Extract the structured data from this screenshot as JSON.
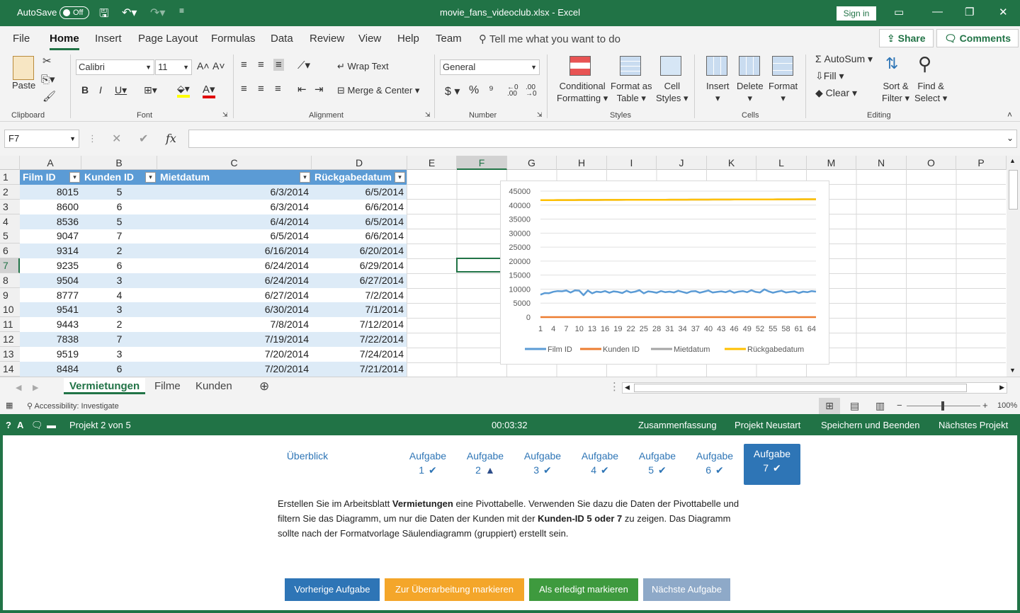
{
  "titlebar": {
    "autosave_label": "AutoSave",
    "autosave_state": "Off",
    "file_title": "movie_fans_videoclub.xlsx - Excel",
    "signin": "Sign in"
  },
  "menu": {
    "tabs": [
      "File",
      "Home",
      "Insert",
      "Page Layout",
      "Formulas",
      "Data",
      "Review",
      "View",
      "Help",
      "Team"
    ],
    "tell_me": "Tell me what you want to do",
    "share": "Share",
    "comments": "Comments"
  },
  "ribbon": {
    "paste": "Paste",
    "clipboard": "Clipboard",
    "font_name": "Calibri",
    "font_size": "11",
    "font": "Font",
    "wrap_text": "Wrap Text",
    "merge_center": "Merge & Center",
    "alignment": "Alignment",
    "number_format": "General",
    "number": "Number",
    "conditional": "Conditional",
    "formatting": "Formatting",
    "format_as": "Format as",
    "table": "Table",
    "cell": "Cell",
    "styles_btn": "Styles",
    "styles": "Styles",
    "insert": "Insert",
    "delete": "Delete",
    "format": "Format",
    "cells": "Cells",
    "autosum": "AutoSum",
    "fill": "Fill",
    "clear": "Clear",
    "sort": "Sort &",
    "filter": "Filter",
    "find": "Find &",
    "select": "Select",
    "editing": "Editing"
  },
  "formula": {
    "namebox": "F7",
    "fx": "fx"
  },
  "columns": [
    "A",
    "B",
    "C",
    "D",
    "E",
    "F",
    "G",
    "H",
    "I",
    "J",
    "K",
    "L",
    "M",
    "N",
    "O",
    "P"
  ],
  "table": {
    "headers": [
      "Film ID",
      "Kunden ID",
      "Mietdatum",
      "Rückgabedatum"
    ],
    "rows": [
      [
        "8015",
        "5",
        "6/3/2014",
        "6/5/2014"
      ],
      [
        "8600",
        "6",
        "6/3/2014",
        "6/6/2014"
      ],
      [
        "8536",
        "5",
        "6/4/2014",
        "6/5/2014"
      ],
      [
        "9047",
        "7",
        "6/5/2014",
        "6/6/2014"
      ],
      [
        "9314",
        "2",
        "6/16/2014",
        "6/20/2014"
      ],
      [
        "9235",
        "6",
        "6/24/2014",
        "6/29/2014"
      ],
      [
        "9504",
        "3",
        "6/24/2014",
        "6/27/2014"
      ],
      [
        "8777",
        "4",
        "6/27/2014",
        "7/2/2014"
      ],
      [
        "9541",
        "3",
        "6/30/2014",
        "7/1/2014"
      ],
      [
        "9443",
        "2",
        "7/8/2014",
        "7/12/2014"
      ],
      [
        "7838",
        "7",
        "7/19/2014",
        "7/22/2014"
      ],
      [
        "9519",
        "3",
        "7/20/2014",
        "7/24/2014"
      ],
      [
        "8484",
        "6",
        "7/20/2014",
        "7/21/2014"
      ]
    ]
  },
  "chart_data": {
    "type": "line",
    "ylim": [
      0,
      45000
    ],
    "yticks": [
      "45000",
      "40000",
      "35000",
      "30000",
      "25000",
      "20000",
      "15000",
      "10000",
      "5000",
      "0"
    ],
    "xticks": [
      "1",
      "4",
      "7",
      "10",
      "13",
      "16",
      "19",
      "22",
      "25",
      "28",
      "31",
      "34",
      "37",
      "40",
      "43",
      "46",
      "49",
      "52",
      "55",
      "58",
      "61",
      "64"
    ],
    "legend_position": "bottom",
    "series": [
      {
        "name": "Film ID",
        "color": "#5b9bd5",
        "values": [
          8015,
          8600,
          8536,
          9047,
          9314,
          9235,
          9504,
          8777,
          9541,
          9443,
          7838,
          9519,
          8484,
          9100,
          8900,
          9300,
          8700,
          9200,
          9000,
          8600,
          9400,
          8800,
          9100,
          9600,
          8500,
          9200,
          9000,
          8700,
          9300,
          8900,
          9100,
          8800,
          9400,
          9000,
          8600,
          9200,
          9300,
          8700,
          9100,
          9500,
          8800,
          9000,
          9200,
          8900,
          9400,
          8700,
          9100,
          9300,
          8900,
          9600,
          9000,
          8800,
          9900,
          9200,
          8700,
          9100,
          9400,
          8800,
          9000,
          9200,
          8600,
          9100,
          8900,
          9300,
          9100
        ]
      },
      {
        "name": "Kunden ID",
        "color": "#ed7d31",
        "values": [
          5,
          6,
          5,
          7,
          2,
          6,
          3,
          4,
          3,
          2,
          7,
          3,
          6,
          5,
          4,
          6,
          2,
          3,
          7,
          5,
          4,
          6,
          3,
          2,
          5,
          7,
          4,
          3,
          6,
          5,
          2,
          4,
          7,
          3,
          6,
          5,
          4,
          2,
          3,
          6,
          7,
          5,
          4,
          3,
          2,
          6,
          5,
          7,
          4,
          3,
          6,
          2,
          5,
          4,
          7,
          3,
          6,
          5,
          2,
          4,
          3,
          6,
          7,
          5,
          4
        ]
      },
      {
        "name": "Mietdatum",
        "color": "#a5a5a5",
        "values": [
          41793,
          41793,
          41794,
          41795,
          41806,
          41814,
          41814,
          41817,
          41820,
          41828,
          41839,
          41840,
          41840,
          41845,
          41850,
          41855,
          41860,
          41865,
          41870,
          41875,
          41880,
          41885,
          41890,
          41895,
          41900,
          41905,
          41910,
          41915,
          41920,
          41925,
          41930,
          41935,
          41940,
          41945,
          41950,
          41955,
          41960,
          41965,
          41970,
          41975,
          41980,
          41985,
          41990,
          41995,
          42000,
          42005,
          42010,
          42015,
          42020,
          42025,
          42030,
          42035,
          42040,
          42045,
          42050,
          42055,
          42060,
          42065,
          42070,
          42075,
          42080,
          42085,
          42090,
          42095,
          42100
        ]
      },
      {
        "name": "Rückgabedatum",
        "color": "#ffc000",
        "values": [
          41795,
          41796,
          41795,
          41796,
          41810,
          41819,
          41817,
          41822,
          41821,
          41832,
          41842,
          41844,
          41841,
          41848,
          41853,
          41858,
          41863,
          41868,
          41873,
          41878,
          41883,
          41888,
          41893,
          41898,
          41903,
          41908,
          41913,
          41918,
          41923,
          41928,
          41933,
          41938,
          41943,
          41948,
          41953,
          41958,
          41963,
          41968,
          41973,
          41978,
          41983,
          41988,
          41993,
          41998,
          42003,
          42008,
          42013,
          42018,
          42023,
          42028,
          42033,
          42038,
          42043,
          42048,
          42053,
          42058,
          42063,
          42068,
          42073,
          42078,
          42083,
          42088,
          42093,
          42098,
          42103
        ]
      }
    ]
  },
  "sheets": [
    "Vermietungen",
    "Filme",
    "Kunden"
  ],
  "status": {
    "accessibility": "Accessibility: Investigate",
    "zoom": "100%"
  },
  "project": {
    "label": "Projekt 2 von 5",
    "timer": "00:03:32",
    "summary": "Zusammenfassung",
    "restart": "Projekt Neustart",
    "save_exit": "Speichern und Beenden",
    "next_project": "Nächstes Projekt"
  },
  "tasks": {
    "overview": "Überblick",
    "items": [
      {
        "label": "Aufgabe",
        "num": "1",
        "mark": "✔"
      },
      {
        "label": "Aufgabe",
        "num": "2",
        "mark": "▲"
      },
      {
        "label": "Aufgabe",
        "num": "3",
        "mark": "✔"
      },
      {
        "label": "Aufgabe",
        "num": "4",
        "mark": "✔"
      },
      {
        "label": "Aufgabe",
        "num": "5",
        "mark": "✔"
      },
      {
        "label": "Aufgabe",
        "num": "6",
        "mark": "✔"
      },
      {
        "label": "Aufgabe",
        "num": "7",
        "mark": "✔"
      }
    ]
  },
  "instruction": {
    "p1": "Erstellen Sie im Arbeitsblatt ",
    "b1": "Vermietungen",
    "p2": " eine Pivottabelle. Verwenden Sie dazu die Daten der Pivottabelle und filtern Sie das Diagramm, um nur die Daten der Kunden mit der ",
    "b2": "Kunden-ID 5 oder 7",
    "p3": " zu zeigen. Das Diagramm sollte nach der Formatvorlage Säulendiagramm (gruppiert) erstellt sein."
  },
  "buttons": {
    "prev": "Vorherige Aufgabe",
    "review": "Zur Überarbeitung markieren",
    "done": "Als erledigt markieren",
    "next": "Nächste Aufgabe",
    "colors": {
      "prev": "#2e75b6",
      "review": "#f4a62a",
      "done": "#3e9a3e",
      "next": "#8ea9c8"
    }
  }
}
